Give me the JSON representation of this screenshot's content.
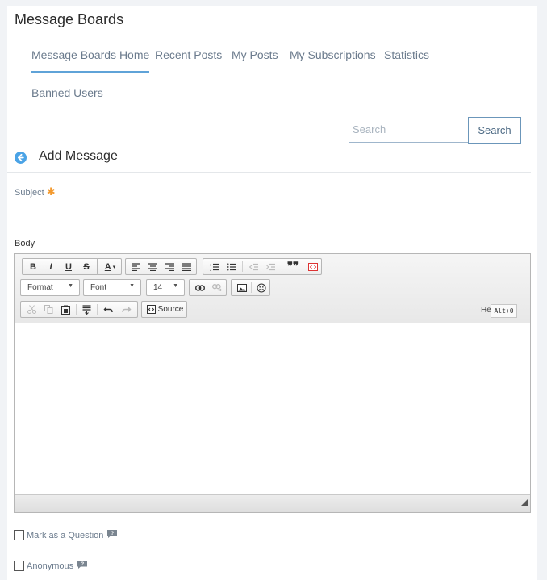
{
  "portlet": {
    "title": "Message Boards"
  },
  "nav": {
    "tabs": [
      {
        "label": "Message Boards Home",
        "active": true
      },
      {
        "label": "Recent Posts"
      },
      {
        "label": "My Posts"
      },
      {
        "label": "My Subscriptions"
      },
      {
        "label": "Statistics"
      },
      {
        "label": "Banned Users"
      }
    ]
  },
  "search": {
    "placeholder": "Search",
    "value": "",
    "button_label": "Search"
  },
  "header": {
    "title": "Add Message",
    "back_icon": "back-arrow-icon"
  },
  "form": {
    "subject_label": "Subject",
    "required_marker": "✱",
    "subject_value": "",
    "body_label": "Body"
  },
  "editor": {
    "toolbar": {
      "bold": "B",
      "italic": "I",
      "underline": "U",
      "strike": "S",
      "text_color": "A",
      "format_label": "Format",
      "font_label": "Font",
      "size_value": "14",
      "source_label": "Source",
      "help_label": "Help",
      "help_shortcut": "Alt+0"
    },
    "content": ""
  },
  "options": {
    "question_label": "Mark as a Question",
    "question_checked": false,
    "anonymous_label": "Anonymous",
    "anonymous_checked": false
  },
  "colors": {
    "accent": "#5fa3d8",
    "required": "#f39a2f",
    "link_text": "#6b7b8d"
  }
}
